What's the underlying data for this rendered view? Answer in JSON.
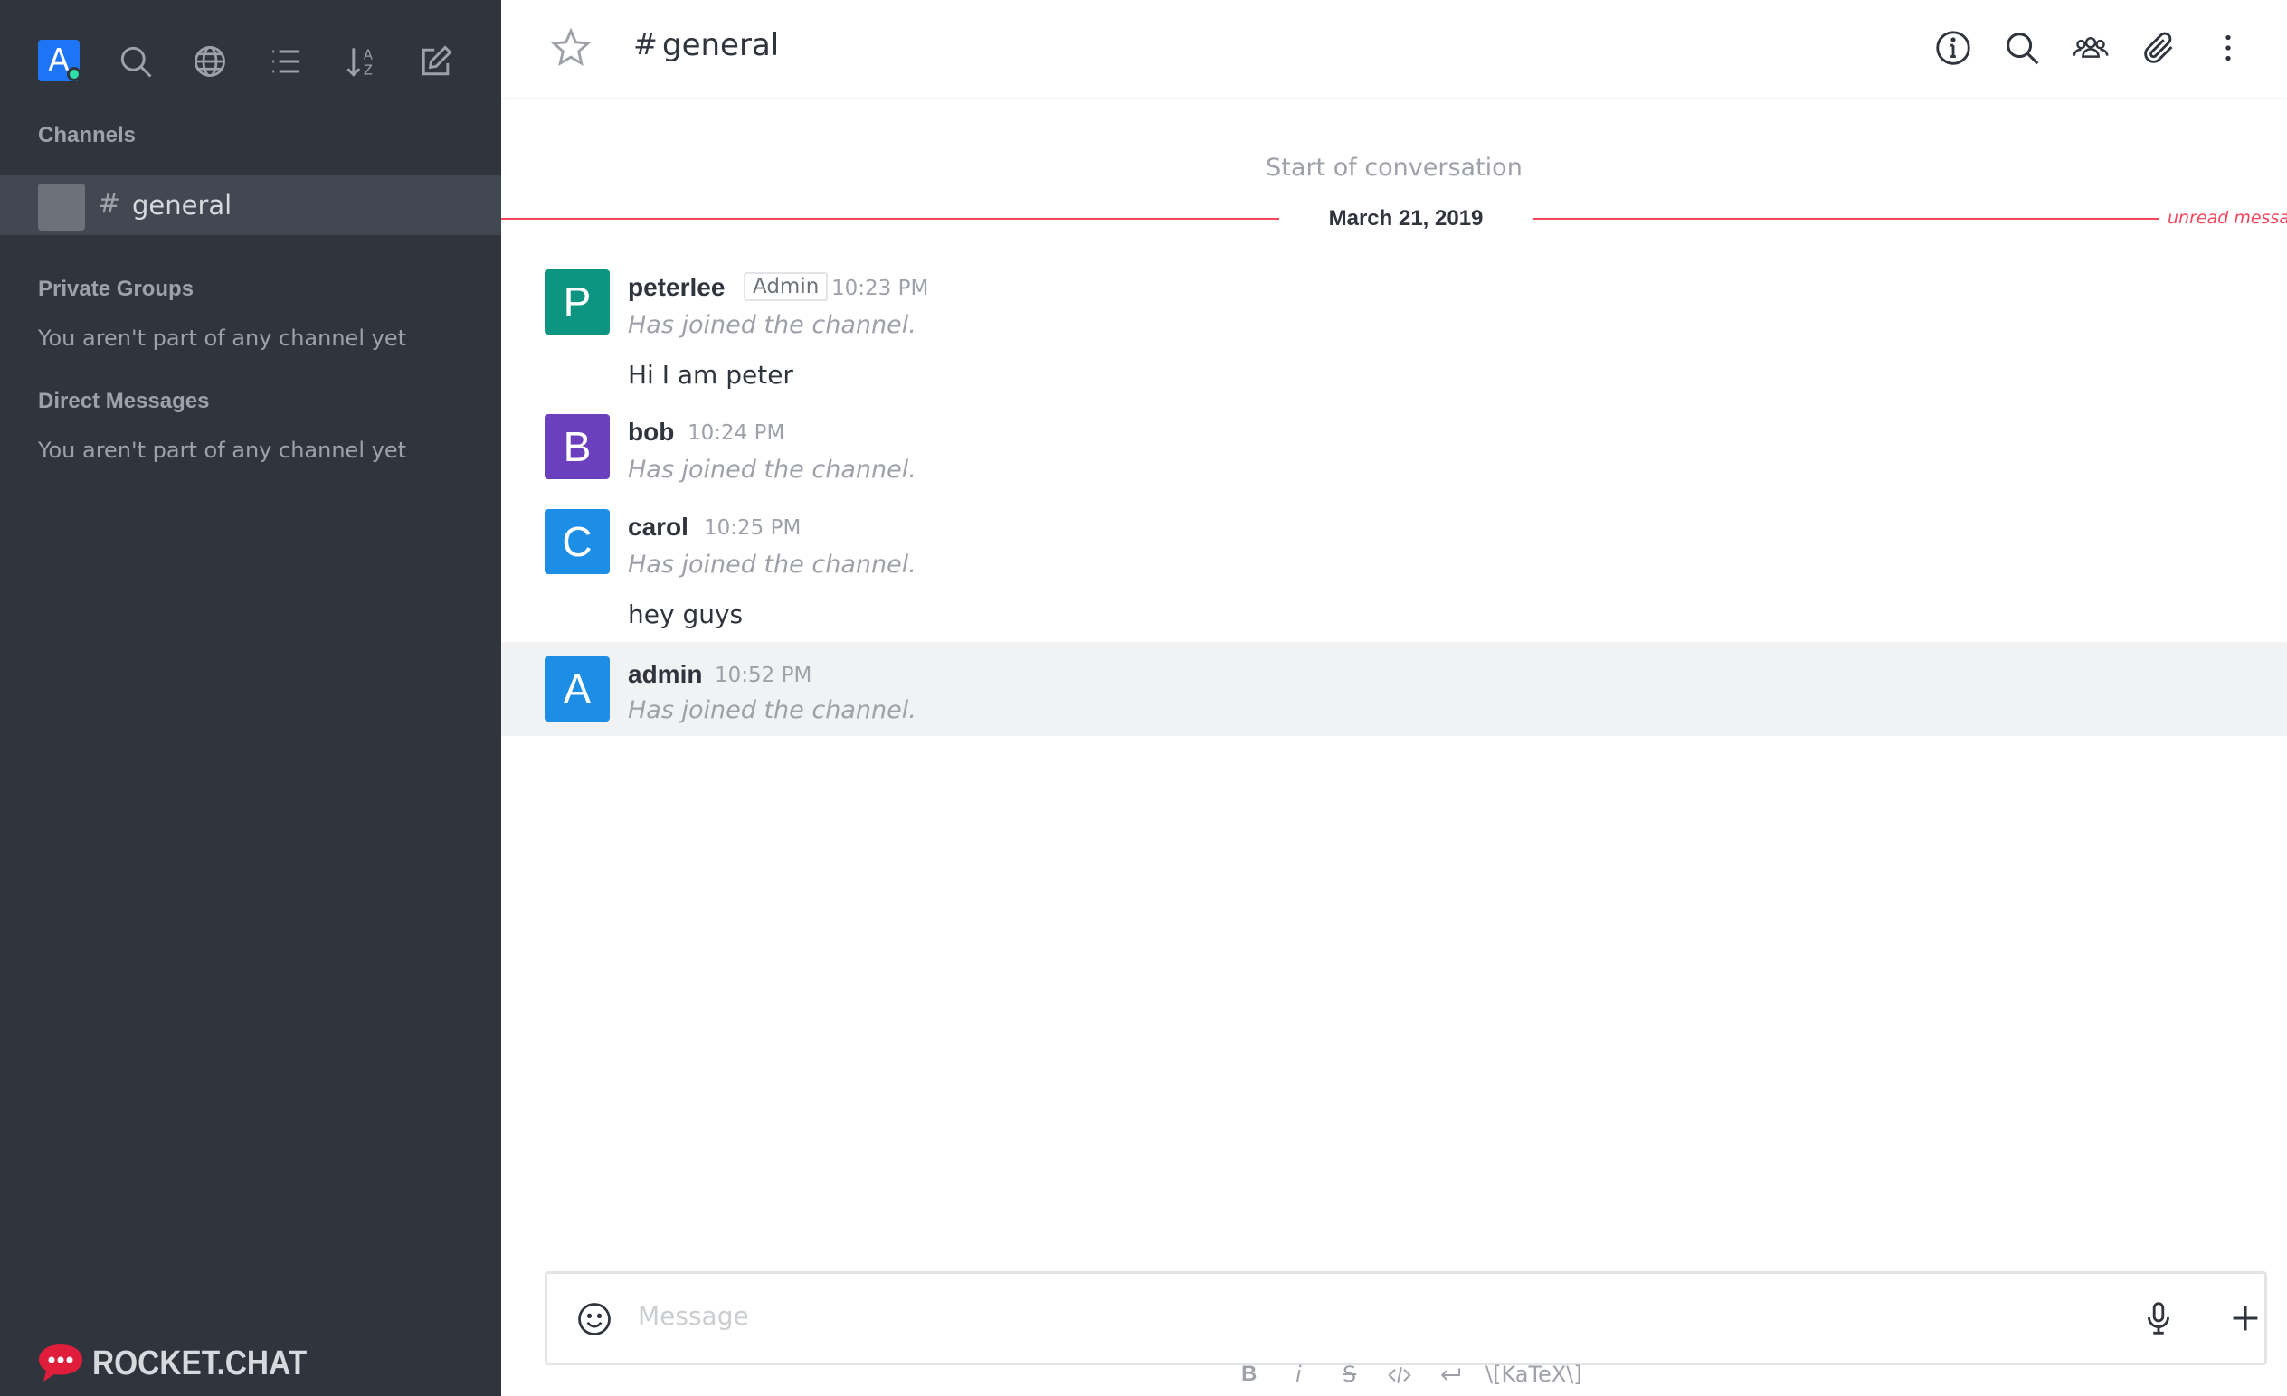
{
  "sidebar": {
    "user_avatar_letter": "A",
    "user_status_color": "#2de0a5",
    "toolbar_icons": [
      "search-icon",
      "globe-icon",
      "list-icon",
      "sort-icon",
      "edit-icon"
    ],
    "sections": {
      "channels": "Channels",
      "private_groups": "Private Groups",
      "direct_messages": "Direct Messages"
    },
    "empty_text_private": "You aren't part of any channel yet",
    "empty_text_direct": "You aren't part of any channel yet",
    "channels": [
      {
        "hash": "#",
        "name": "general"
      }
    ],
    "logo_text": "ROCKET.CHAT"
  },
  "header": {
    "hash": "#",
    "room_name": "general",
    "icons": [
      "info-icon",
      "search-icon",
      "members-icon",
      "attachment-icon",
      "kebab-menu-icon"
    ]
  },
  "conversation": {
    "start_label": "Start of conversation",
    "date_divider": "March 21, 2019",
    "unread_label": "unread messag",
    "messages": [
      {
        "avatar_letter": "P",
        "avatar_color": "#0d9582",
        "username": "peterlee",
        "role": "Admin",
        "time": "10:23 PM",
        "system_text": "Has joined the channel.",
        "text": "Hi I am peter"
      },
      {
        "avatar_letter": "B",
        "avatar_color": "#6b3fbd",
        "username": "bob",
        "time": "10:24 PM",
        "system_text": "Has joined the channel."
      },
      {
        "avatar_letter": "C",
        "avatar_color": "#1d8ee6",
        "username": "carol",
        "time": "10:25 PM",
        "system_text": "Has joined the channel.",
        "text": "hey guys"
      },
      {
        "avatar_letter": "A",
        "avatar_color": "#1d8ee6",
        "username": "admin",
        "time": "10:52 PM",
        "system_text": "Has joined the channel."
      }
    ]
  },
  "composer": {
    "placeholder": "Message",
    "format_bold": "B",
    "format_italic": "i",
    "format_strike": "S",
    "katex_label": "\\[KaTeX\\]"
  },
  "colors": {
    "sidebar_bg": "#2f343d",
    "accent": "#1d74f5",
    "unread": "#f5455c"
  }
}
